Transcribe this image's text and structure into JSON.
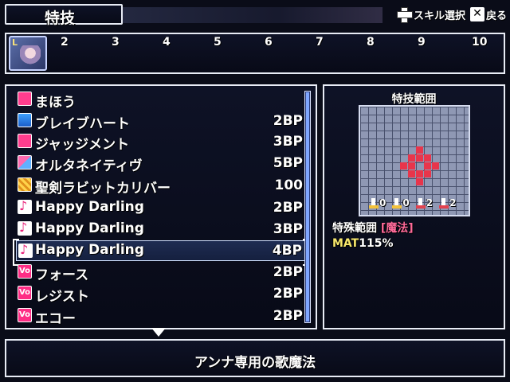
{
  "header": {
    "title": "特技"
  },
  "hint": {
    "select_label": "スキル選択",
    "back_label": "戻る"
  },
  "level_bar": {
    "portrait_badge": "L",
    "levels": [
      "2",
      "3",
      "4",
      "5",
      "6",
      "7",
      "8",
      "9",
      "10"
    ]
  },
  "skills": [
    {
      "name": "まほう",
      "cost": "",
      "icon": "pink-magic-icon"
    },
    {
      "name": "ブレイブハート",
      "cost": "2BP",
      "icon": "blue-buff-icon"
    },
    {
      "name": "ジャッジメント",
      "cost": "3BP",
      "icon": "pink-judgment-icon"
    },
    {
      "name": "オルタネイティヴ",
      "cost": "5BP",
      "icon": "alternative-icon"
    },
    {
      "name": "聖剣ラビットカリバー",
      "cost": "100",
      "icon": "sword-icon"
    },
    {
      "name": "Happy Darling",
      "cost": "2BP",
      "icon": "music-note-icon"
    },
    {
      "name": "Happy Darling",
      "cost": "3BP",
      "icon": "music-note-plus-icon"
    },
    {
      "name": "Happy Darling",
      "cost": "4BP",
      "icon": "music-note-plus2-icon"
    },
    {
      "name": "フォース",
      "cost": "2BP",
      "icon": "vo-icon"
    },
    {
      "name": "レジスト",
      "cost": "2BP",
      "icon": "vo-icon"
    },
    {
      "name": "エコー",
      "cost": "2BP",
      "icon": "vo-icon"
    }
  ],
  "selected_index": 7,
  "range_panel": {
    "title": "特技範囲",
    "stats": [
      {
        "value": "0",
        "color": "#f3c23b"
      },
      {
        "value": "0",
        "color": "#f3c23b"
      },
      {
        "value": "2",
        "color": "#e2424f"
      },
      {
        "value": "2",
        "color": "#e2424f"
      }
    ],
    "range_type_label": "特殊範囲",
    "range_type_open": "[",
    "range_type_value": "魔法",
    "range_type_close": "]",
    "power_key": "MAT",
    "power_value": "115%"
  },
  "description": "アンナ専用の歌魔法",
  "colors": {
    "accent_red": "#e8354b",
    "highlight_yellow": "#f7e86c",
    "bracket_pink": "#ff6a9a"
  }
}
